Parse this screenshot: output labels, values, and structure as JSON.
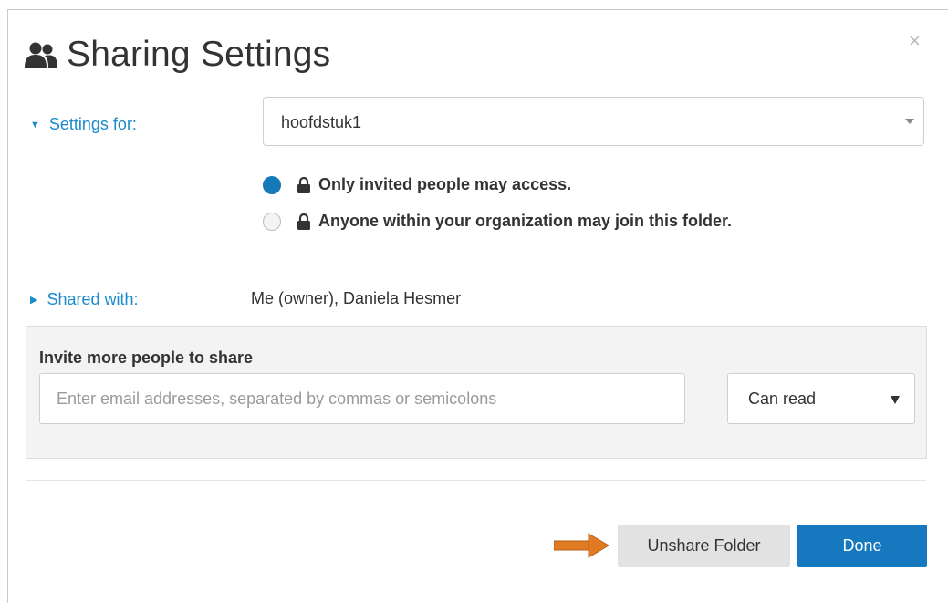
{
  "dialog": {
    "title": "Sharing Settings",
    "close_label": "×"
  },
  "settings": {
    "label": "Settings for:",
    "selected_folder": "hoofdstuk1",
    "options": [
      {
        "label": "Only invited people may access.",
        "selected": true
      },
      {
        "label": "Anyone within your organization may join this folder.",
        "selected": false
      }
    ]
  },
  "shared": {
    "label": "Shared with:",
    "value": "Me (owner), Daniela Hesmer"
  },
  "invite": {
    "title": "Invite more people to share",
    "placeholder": "Enter email addresses, separated by commas or semicolons",
    "permission": "Can read"
  },
  "actions": {
    "unshare_label": "Unshare Folder",
    "done_label": "Done"
  },
  "icons": {
    "title_icon": "users-icon",
    "lock_icon": "lock-icon",
    "close_icon": "close-icon",
    "annotation": "orange-arrow-icon"
  },
  "colors": {
    "accent": "#1a8acb",
    "primary_button": "#1678bf",
    "annotation_arrow": "#e07b24"
  }
}
